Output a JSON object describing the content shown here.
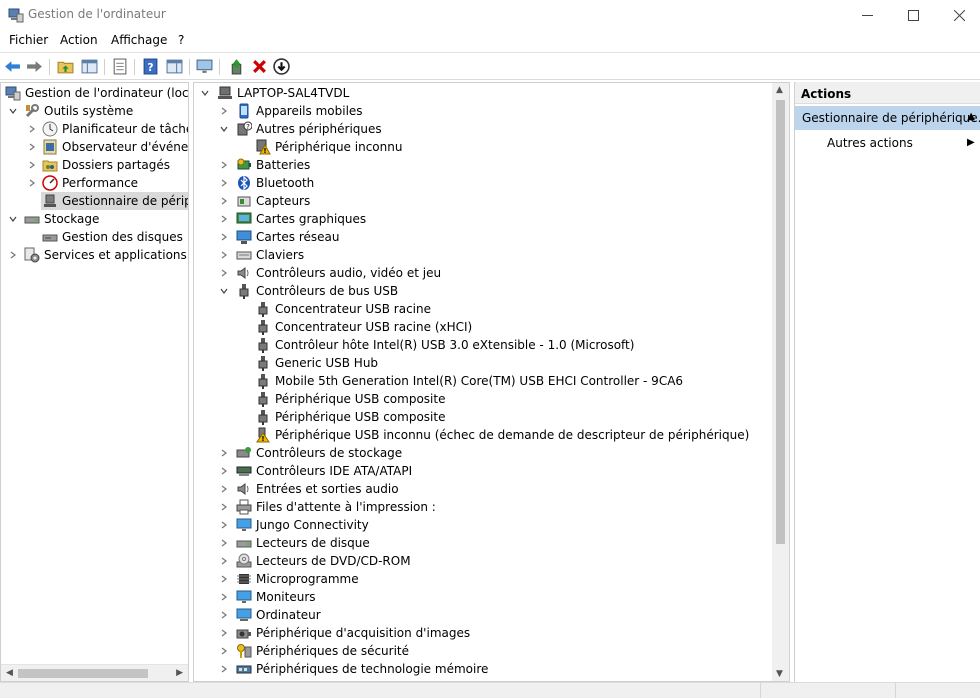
{
  "window": {
    "title": "Gestion de l'ordinateur"
  },
  "menu": [
    "Fichier",
    "Action",
    "Affichage",
    "?"
  ],
  "toolbar": {
    "buttons": [
      "back-icon",
      "forward-icon",
      "up-folder-icon",
      "show-hide-tree-icon",
      "properties-icon",
      "help-icon",
      "show-hide-action-icon",
      "monitor-icon",
      "update-driver-icon",
      "uninstall-icon",
      "disable-device-icon"
    ]
  },
  "left_tree": {
    "items": [
      {
        "label": "Gestion de l'ordinateur (local)",
        "icon": "computer-management-icon"
      },
      {
        "label": "Outils système",
        "icon": "tools-icon"
      },
      {
        "label": "Planificateur de tâches",
        "icon": "clock-icon"
      },
      {
        "label": "Observateur d'événeme",
        "icon": "event-viewer-icon"
      },
      {
        "label": "Dossiers partagés",
        "icon": "shared-folder-icon"
      },
      {
        "label": "Performance",
        "icon": "performance-icon"
      },
      {
        "label": "Gestionnaire de périphé",
        "icon": "device-manager-icon"
      },
      {
        "label": "Stockage",
        "icon": "storage-icon"
      },
      {
        "label": "Gestion des disques",
        "icon": "disk-management-icon"
      },
      {
        "label": "Services et applications",
        "icon": "services-icon"
      }
    ]
  },
  "device_tree": {
    "root": "LAPTOP-SAL4TVDL",
    "items": [
      {
        "label": "Appareils mobiles",
        "icon": "mobile-icon"
      },
      {
        "label": "Autres périphériques",
        "icon": "unknown-device-icon"
      },
      {
        "label": "Périphérique inconnu",
        "icon": "warning-device-icon"
      },
      {
        "label": "Batteries",
        "icon": "battery-icon"
      },
      {
        "label": "Bluetooth",
        "icon": "bluetooth-icon"
      },
      {
        "label": "Capteurs",
        "icon": "sensor-icon"
      },
      {
        "label": "Cartes graphiques",
        "icon": "display-adapter-icon"
      },
      {
        "label": "Cartes réseau",
        "icon": "network-adapter-icon"
      },
      {
        "label": "Claviers",
        "icon": "keyboard-icon"
      },
      {
        "label": "Contrôleurs audio, vidéo et jeu",
        "icon": "speaker-icon"
      },
      {
        "label": "Contrôleurs de bus USB",
        "icon": "usb-icon"
      },
      {
        "label": "Concentrateur USB racine",
        "icon": "usb-icon"
      },
      {
        "label": "Concentrateur USB racine (xHCI)",
        "icon": "usb-icon"
      },
      {
        "label": "Contrôleur hôte Intel(R) USB 3.0 eXtensible - 1.0 (Microsoft)",
        "icon": "usb-icon"
      },
      {
        "label": "Generic USB Hub",
        "icon": "usb-icon"
      },
      {
        "label": "Mobile 5th Generation Intel(R) Core(TM) USB EHCI Controller - 9CA6",
        "icon": "usb-icon"
      },
      {
        "label": "Périphérique USB composite",
        "icon": "usb-icon"
      },
      {
        "label": "Périphérique USB composite",
        "icon": "usb-icon"
      },
      {
        "label": "Périphérique USB inconnu (échec de demande de descripteur de périphérique)",
        "icon": "usb-warning-icon"
      },
      {
        "label": "Contrôleurs de stockage",
        "icon": "storage-controller-icon"
      },
      {
        "label": "Contrôleurs IDE ATA/ATAPI",
        "icon": "ide-controller-icon"
      },
      {
        "label": "Entrées et sorties audio",
        "icon": "speaker-icon"
      },
      {
        "label": "Files d'attente à l'impression :",
        "icon": "printer-icon"
      },
      {
        "label": "Jungo Connectivity",
        "icon": "monitor-icon"
      },
      {
        "label": "Lecteurs de disque",
        "icon": "disk-drive-icon"
      },
      {
        "label": "Lecteurs de DVD/CD-ROM",
        "icon": "dvd-icon"
      },
      {
        "label": "Microprogramme",
        "icon": "firmware-icon"
      },
      {
        "label": "Moniteurs",
        "icon": "monitor-icon"
      },
      {
        "label": "Ordinateur",
        "icon": "computer-icon"
      },
      {
        "label": "Périphérique d'acquisition d'images",
        "icon": "camera-icon"
      },
      {
        "label": "Périphériques de sécurité",
        "icon": "security-icon"
      },
      {
        "label": "Périphériques de technologie mémoire",
        "icon": "memory-icon"
      }
    ]
  },
  "actions": {
    "header": "Actions",
    "section": "Gestionnaire de périphérique...",
    "items": [
      "Autres actions"
    ]
  },
  "colors": {
    "selection": "#d9d9d9",
    "actions_section": "#bcd4ec",
    "warning": "#e8a500",
    "uninstall": "#d10000"
  }
}
